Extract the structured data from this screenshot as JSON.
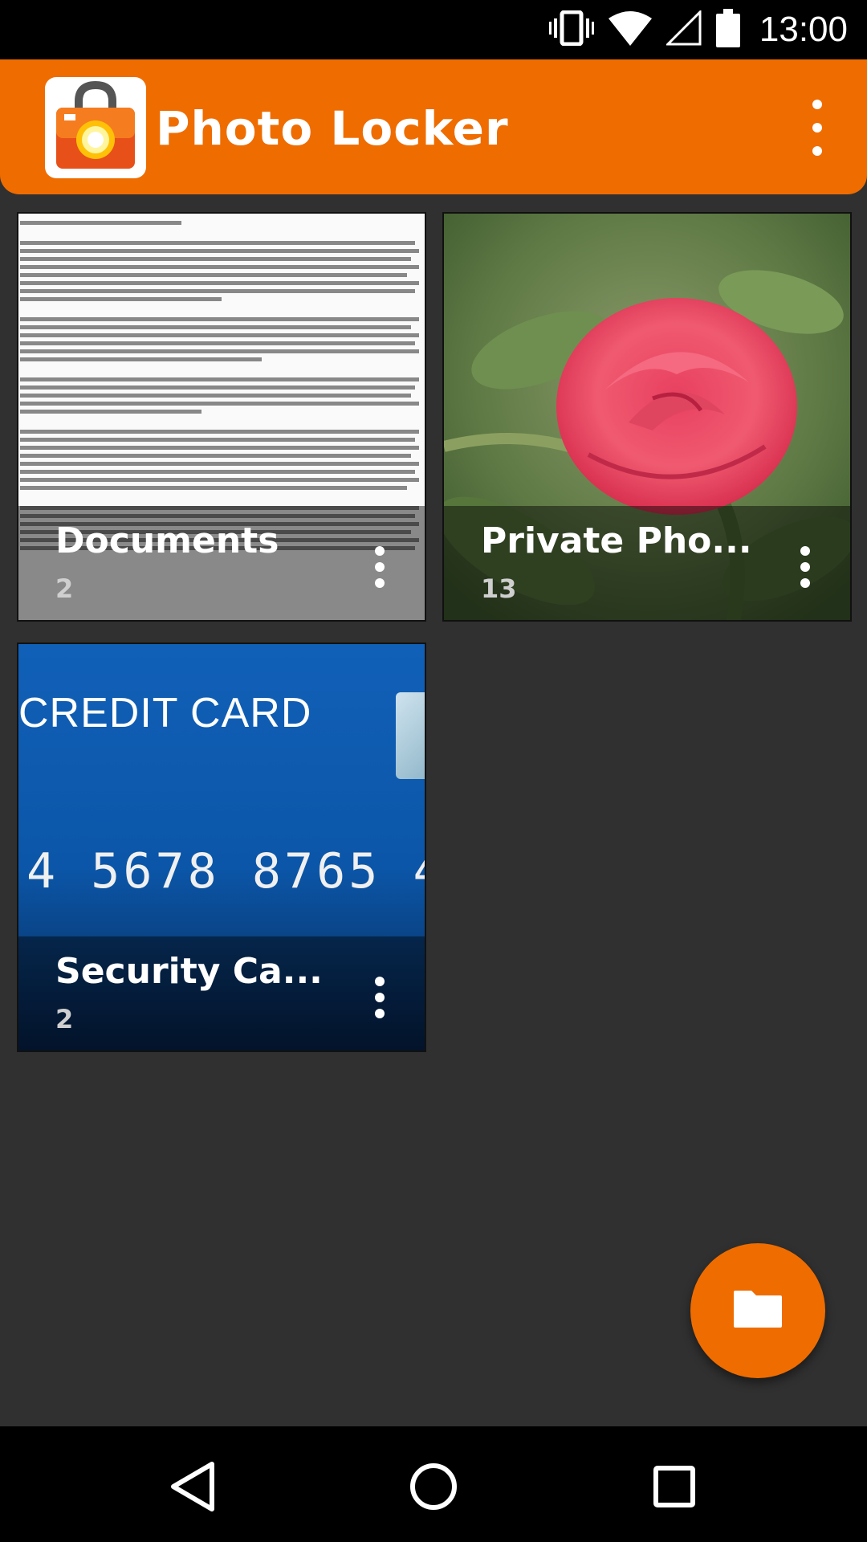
{
  "status_bar": {
    "time": "13:00",
    "icons": [
      "vibrate-icon",
      "wifi-icon",
      "cell-signal-icon",
      "battery-icon"
    ]
  },
  "app_bar": {
    "title": "Photo Locker",
    "logo_icon": "camera-lock-icon",
    "menu_icon": "more-vert-icon"
  },
  "albums": [
    {
      "name": "Documents",
      "count": "2",
      "thumb": "document-page"
    },
    {
      "name": "Private Pho...",
      "count": "13",
      "thumb": "rose-photo"
    },
    {
      "name": "Security Ca...",
      "count": "2",
      "thumb": "credit-card",
      "card_title": "CREDIT CARD",
      "card_number": "4 5678 8765 4"
    }
  ],
  "fab": {
    "icon": "folder-icon"
  },
  "nav_bar": {
    "icons": [
      "back-icon",
      "home-icon",
      "recents-icon"
    ]
  },
  "colors": {
    "accent": "#ef6c00",
    "background": "#303030",
    "bars": "#000000"
  }
}
